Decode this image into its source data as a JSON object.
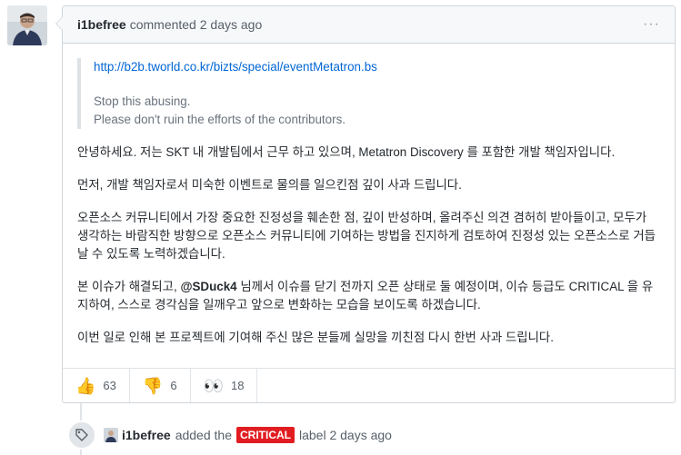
{
  "comment": {
    "author": "i1befree",
    "meta": "commented 2 days ago",
    "menu_glyph": "···",
    "quote": {
      "link": "http://b2b.tworld.co.kr/bizts/special/eventMetatron.bs",
      "line1": "Stop this abusing.",
      "line2": "Please don't ruin the efforts of the contributors."
    },
    "paragraphs": [
      "안녕하세요. 저는 SKT 내 개발팀에서 근무 하고 있으며, Metatron Discovery 를 포함한 개발 책임자입니다.",
      "먼저, 개발 책임자로서 미숙한 이벤트로 물의를 일으킨점 깊이 사과 드립니다.",
      "오픈소스 커뮤니티에서 가장 중요한 진정성을 훼손한 점, 깊이 반성하며, 올려주신 의견 겸허히 받아들이고, 모두가 생각하는 바람직한 방향으로 오픈소스 커뮤니티에 기여하는 방법을 진지하게 검토하여 진정성 있는 오픈소스로 거듭날 수 있도록 노력하겠습니다.",
      "이번 일로 인해 본 프로젝트에 기여해 주신 많은 분들께 실망을 끼친점 다시 한번 사과 드립니다."
    ],
    "p4": {
      "before": "본 이슈가 해결되고, ",
      "mention": "@SDuck4",
      "after": " 님께서 이슈를 닫기 전까지 오픈 상태로 둘 예정이며, 이슈 등급도 CRITICAL 을 유지하여, 스스로 경각심을 일깨우고 앞으로 변화하는 모습을 보이도록 하겠습니다."
    },
    "reactions": [
      {
        "icon": "thumbs-up-icon",
        "emoji": "👍",
        "count": "63"
      },
      {
        "icon": "thumbs-down-icon",
        "emoji": "👎",
        "count": "6"
      },
      {
        "icon": "eyes-icon",
        "emoji": "👀",
        "count": "18"
      }
    ]
  },
  "event": {
    "author": "i1befree",
    "action": "added the",
    "label": "CRITICAL",
    "label_color": "#e11d21",
    "suffix": "label 2 days ago",
    "icon": "tag-icon"
  }
}
